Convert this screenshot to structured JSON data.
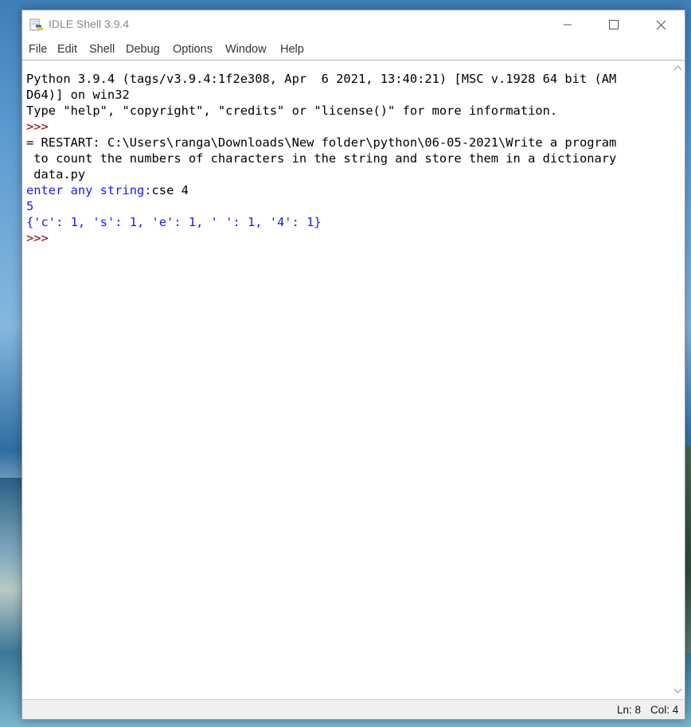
{
  "window": {
    "title": "IDLE Shell 3.9.4"
  },
  "menu": {
    "items": [
      "File",
      "Edit",
      "Shell",
      "Debug",
      "Options",
      "Window",
      "Help"
    ]
  },
  "shell": {
    "lines": [
      {
        "text": "Python 3.9.4 (tags/v3.9.4:1f2e308, Apr  6 2021, 13:40:21) [MSC v.1928 64 bit (AM",
        "style": "stdout"
      },
      {
        "text": "D64)] on win32",
        "style": "stdout"
      },
      {
        "text": "Type \"help\", \"copyright\", \"credits\" or \"license()\" for more information.",
        "style": "stdout"
      },
      {
        "text": ">>> ",
        "style": "prompt"
      },
      {
        "text": "= RESTART: C:\\Users\\ranga\\Downloads\\New folder\\python\\06-05-2021\\Write a program",
        "style": "stdout"
      },
      {
        "text": " to count the numbers of characters in the string and store them in a dictionary",
        "style": "stdout"
      },
      {
        "text": " data.py",
        "style": "stdout"
      },
      {
        "prefix": "enter any string:",
        "input": "cse 4",
        "style": "mixed"
      },
      {
        "text": "5",
        "style": "output"
      },
      {
        "text": "{'c': 1, 's': 1, 'e': 1, ' ': 1, '4': 1}",
        "style": "output"
      },
      {
        "text": ">>> ",
        "style": "prompt"
      }
    ]
  },
  "status": {
    "line": "Ln: 8",
    "col": "Col: 4"
  },
  "colors": {
    "stdout": "#000000",
    "output": "#1a1aff",
    "prompt": "#a00000"
  },
  "icons": {
    "app": "python-idle-icon",
    "minimize": "minimize-icon",
    "maximize": "maximize-icon",
    "close": "close-icon"
  }
}
